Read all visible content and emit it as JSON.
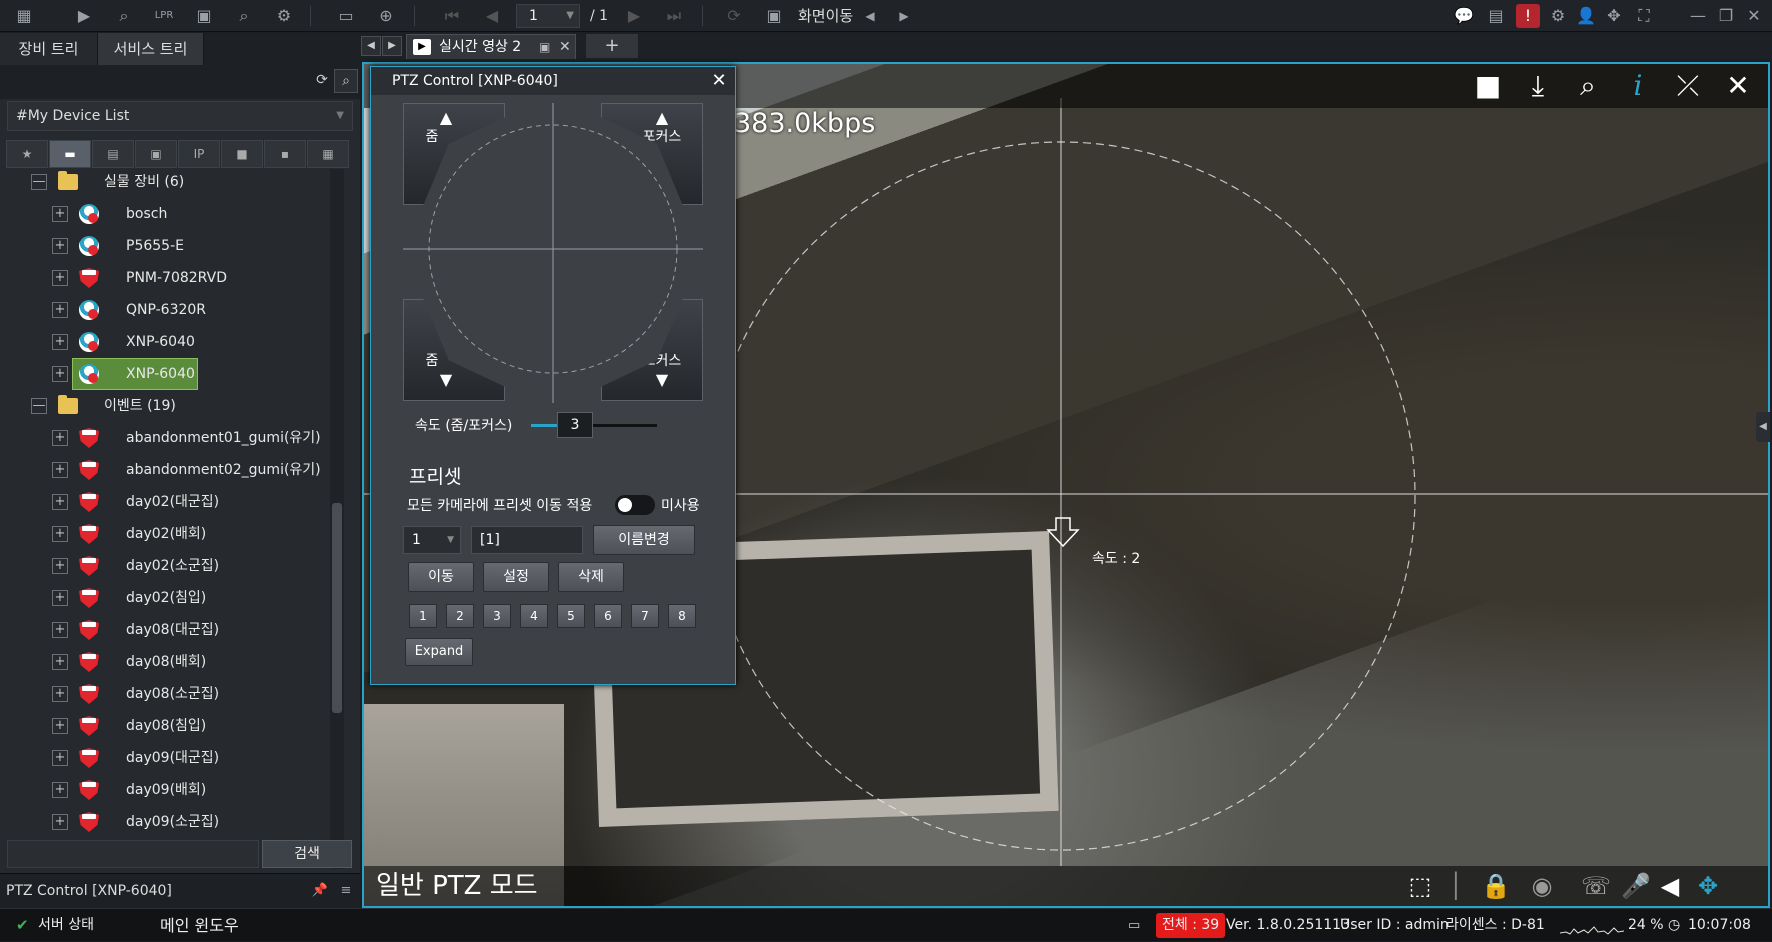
{
  "topbar": {
    "page_current": "1",
    "page_total": "/ 1",
    "screen_move_label": "화면이동"
  },
  "left_panel": {
    "tabs": [
      "장비 트리",
      "서비스 트리"
    ],
    "device_list_select": "#My Device List",
    "filter_tab_ip": "IP",
    "tree": [
      {
        "type": "folder",
        "label": "실물 장비 (6)"
      },
      {
        "type": "camera",
        "label": "bosch"
      },
      {
        "type": "camera",
        "label": "P5655-E"
      },
      {
        "type": "camera-off",
        "label": "PNM-7082RVD"
      },
      {
        "type": "camera",
        "label": "QNP-6320R"
      },
      {
        "type": "camera",
        "label": "XNP-6040"
      },
      {
        "type": "camera",
        "label": "XNP-6040",
        "selected": true
      },
      {
        "type": "folder",
        "label": "이벤트 (19)"
      },
      {
        "type": "event",
        "label": "abandonment01_gumi(유기)"
      },
      {
        "type": "event",
        "label": "abandonment02_gumi(유기)"
      },
      {
        "type": "event",
        "label": "day02(대군집)"
      },
      {
        "type": "event",
        "label": "day02(배회)"
      },
      {
        "type": "event",
        "label": "day02(소군집)"
      },
      {
        "type": "event",
        "label": "day02(침입)"
      },
      {
        "type": "event",
        "label": "day08(대군집)"
      },
      {
        "type": "event",
        "label": "day08(배회)"
      },
      {
        "type": "event",
        "label": "day08(소군집)"
      },
      {
        "type": "event",
        "label": "day08(침입)"
      },
      {
        "type": "event",
        "label": "day09(대군집)"
      },
      {
        "type": "event",
        "label": "day09(배회)"
      },
      {
        "type": "event",
        "label": "day09(소군집)"
      }
    ],
    "search_button": "검색",
    "bottom_panel_title": "PTZ Control [XNP-6040]"
  },
  "video_tab": {
    "label": "실시간 영상 2"
  },
  "video": {
    "bitrate": "383.0kbps",
    "speed_label": "속도 : 2",
    "mode_label": "일반 PTZ 모드"
  },
  "ptz": {
    "title": "PTZ Control [XNP-6040]",
    "zoom": "줌",
    "focus": "포커스",
    "speed_label": "속도 (줌/포커스)",
    "speed_value": "3",
    "preset_title": "프리셋",
    "apply_all_label": "모든 카메라에 프리셋 이동 적용",
    "apply_all_state": "미사용",
    "preset_number": "1",
    "preset_name": "[1]",
    "rename_button": "이름변경",
    "move_button": "이동",
    "set_button": "설정",
    "delete_button": "삭제",
    "numbers": [
      "1",
      "2",
      "3",
      "4",
      "5",
      "6",
      "7",
      "8"
    ],
    "expand_button": "Expand"
  },
  "status_bar": {
    "server_status": "서버 상태",
    "main_window": "메인 윈도우",
    "total_events": "전체 : 39",
    "version": "Ver. 1.8.0.251113",
    "user": "User ID : admin",
    "license": "라이센스 : D-81",
    "cpu": "24 %",
    "time": "10:07:08"
  },
  "colors": {
    "accent": "#2aa3c8",
    "selected": "#5a8c3b",
    "alert": "#e3262e"
  }
}
